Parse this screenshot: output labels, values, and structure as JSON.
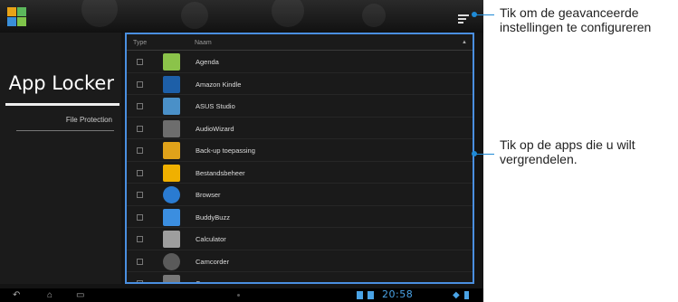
{
  "top_bar": {
    "app_icon": "app-locker-icon",
    "overflow_icon": "overflow-menu-icon"
  },
  "sidebar": {
    "title": "App Locker",
    "item": "File Protection"
  },
  "list": {
    "header_type": "Type",
    "header_name": "Naam",
    "sort_icon": "▲",
    "apps": [
      {
        "name": "Agenda",
        "icon": "calendar-icon",
        "color": "#8bc34a"
      },
      {
        "name": "Amazon Kindle",
        "icon": "kindle-icon",
        "color": "#1d5fa8"
      },
      {
        "name": "ASUS Studio",
        "icon": "studio-icon",
        "color": "#4a90c8"
      },
      {
        "name": "AudioWizard",
        "icon": "audiowizard-icon",
        "color": "#6d6d6d"
      },
      {
        "name": "Back-up toepassing",
        "icon": "backup-icon",
        "color": "#e0a21a"
      },
      {
        "name": "Bestandsbeheer",
        "icon": "file-manager-icon",
        "color": "#f0b000"
      },
      {
        "name": "Browser",
        "icon": "globe-icon",
        "color": "#2a7bd1"
      },
      {
        "name": "BuddyBuzz",
        "icon": "buddybuzz-icon",
        "color": "#3b8ee0"
      },
      {
        "name": "Calculator",
        "icon": "calculator-icon",
        "color": "#9e9e9e"
      },
      {
        "name": "Camcorder",
        "icon": "camcorder-icon",
        "color": "#5a5a5a"
      },
      {
        "name": "Camera",
        "icon": "camera-icon",
        "color": "#777777"
      }
    ]
  },
  "navbar": {
    "back_icon": "back-icon",
    "home_icon": "home-icon",
    "recent_icon": "recent-apps-icon",
    "clock": "20:58"
  },
  "callouts": {
    "top": "Tik om de geavanceerde instellingen te configureren",
    "middle": "Tik op de apps die u wilt vergrendelen."
  },
  "colors": {
    "accent": "#4a8fe0",
    "callout": "#1f8ad6",
    "status": "#4aa3e6"
  }
}
